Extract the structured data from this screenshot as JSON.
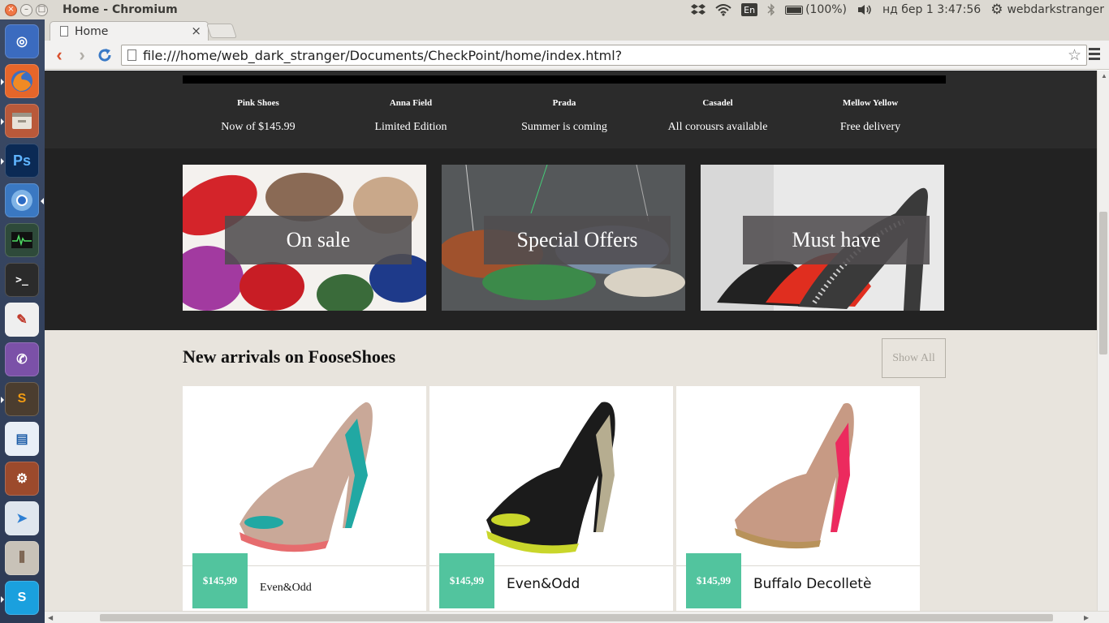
{
  "panel": {
    "window_title": "Home - Chromium",
    "keyboard_layout": "En",
    "battery": "(100%)",
    "datetime": "нд бер  1  3:47:56",
    "username": "webdarkstranger"
  },
  "launcher": {
    "items": [
      "dash-home",
      "firefox",
      "files",
      "photoshop",
      "chromium",
      "system-monitor",
      "terminal",
      "text-editor",
      "viber",
      "sublime-text",
      "libreoffice-writer",
      "system-settings",
      "skype-like-app",
      "mixer",
      "skype",
      "disk"
    ]
  },
  "browser": {
    "tab_title": "Home",
    "tab_close": "×",
    "url": "file:///home/web_dark_stranger/Documents/CheckPoint/home/index.html?"
  },
  "page": {
    "brands": [
      {
        "name": "Pink Shoes",
        "note": "Now of $145.99"
      },
      {
        "name": "Anna Field",
        "note": "Limited Edition"
      },
      {
        "name": "Prada",
        "note": "Summer is coming"
      },
      {
        "name": "Casadel",
        "note": "All corousrs available"
      },
      {
        "name": "Mellow Yellow",
        "note": "Free delivery"
      }
    ],
    "promos": [
      {
        "label": "On sale"
      },
      {
        "label": "Special Offers"
      },
      {
        "label": "Must have"
      }
    ],
    "arrivals_title": "New arrivals on FooseShoes",
    "show_all": "Show All",
    "products": [
      {
        "price": "$145,99",
        "name": "Even&Odd"
      },
      {
        "price": "$145,99",
        "name": "Even&Odd"
      },
      {
        "price": "$145,99",
        "name": "Buffalo Decolletè"
      }
    ]
  },
  "colors": {
    "price_tag": "#52c49e",
    "dark_band": "#2b2b2b",
    "page_bg": "#e8e4dd"
  }
}
